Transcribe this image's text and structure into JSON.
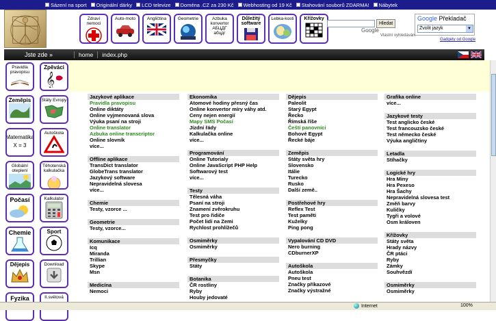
{
  "adbar": [
    "Sázení na sport",
    "Originální dárky",
    "LCD televize",
    "Doména .CZ za 230 Kč",
    "Webhosting od 19 Kč",
    "Stahování souborů ZDARMA!",
    "Nábytek"
  ],
  "header": {
    "categories": [
      {
        "label": "Zdraví nemoci",
        "bold": false
      },
      {
        "label": "Auto-moto",
        "bold": false
      },
      {
        "label": "Angličtina",
        "bold": false
      },
      {
        "label": "Geometrie",
        "bold": false
      },
      {
        "label": "Azbuka konvertor АБЦДГ абцдг",
        "bold": false
      },
      {
        "label": "Důležitý software",
        "bold": true
      },
      {
        "label": "Lebka-kosti",
        "bold": false
      },
      {
        "label": "Křížovky",
        "bold": true
      }
    ],
    "search_button": "Hledat",
    "search_label": "Vlastní vyhledávání",
    "google": "Google",
    "translator_title": "Překladač",
    "translator_select": "Zvolit jazyk",
    "translator_link": "Gadgety od Google"
  },
  "nav": {
    "here": "Jste zde »",
    "crumbs": [
      "home",
      "index.php"
    ]
  },
  "sidebar": [
    {
      "label": "Pravidla pravopisu"
    },
    {
      "label": "Zpěváci"
    },
    {
      "label": "Zeměpis"
    },
    {
      "label": "Státy Evropy"
    },
    {
      "label": "Matematika X = 3"
    },
    {
      "label": "Autoškola"
    },
    {
      "label": "Globální oteplení"
    },
    {
      "label": "Těhotenská kalkulačka"
    },
    {
      "label": "Počasí"
    },
    {
      "label": "Kalkulator"
    },
    {
      "label": "Chemie"
    },
    {
      "label": "Sport"
    },
    {
      "label": "Dějepis"
    },
    {
      "label": "Download"
    },
    {
      "label": "Fyzika"
    },
    {
      "label": "II.světová"
    }
  ],
  "columns": [
    [
      {
        "title": "Jazykové aplikace",
        "items": [
          {
            "t": "Pravidla pravopisu",
            "g": true
          },
          {
            "t": "Online diktáty",
            "g": false
          },
          {
            "t": "Online vyjmenovaná slova",
            "g": false
          },
          {
            "t": "Výuka psaní na stroji",
            "g": false
          },
          {
            "t": "Online translator",
            "g": true
          },
          {
            "t": "Azbuka online transcriptor",
            "g": true
          },
          {
            "t": "Online slovník",
            "g": false
          },
          {
            "t": "více...",
            "g": false
          }
        ]
      },
      {
        "title": "Offline aplikace",
        "items": [
          {
            "t": "TransDict translator",
            "g": false
          },
          {
            "t": "GlobeTrans translator",
            "g": false
          },
          {
            "t": "Jazykový software",
            "g": false
          },
          {
            "t": "Nepravidelná slovesa",
            "g": false
          },
          {
            "t": "více...",
            "g": false
          }
        ]
      },
      {
        "title": "Chemie",
        "items": [
          {
            "t": "Testy, vzorce ...",
            "g": false
          }
        ]
      },
      {
        "title": "Geometrie",
        "items": [
          {
            "t": "Testy, vzorce...",
            "g": false
          }
        ]
      },
      {
        "title": "Komunikace",
        "items": [
          {
            "t": "Icq",
            "g": false
          },
          {
            "t": "Miranda",
            "g": false
          },
          {
            "t": "Trillian",
            "g": false
          },
          {
            "t": "Skype",
            "g": false
          },
          {
            "t": "Msn",
            "g": false
          }
        ]
      },
      {
        "title": "Medicína",
        "items": [
          {
            "t": "Nemoci",
            "g": false
          }
        ]
      }
    ],
    [
      {
        "title": "Ekonomika",
        "items": [
          {
            "t": "Atomové hodiny přesný čas",
            "g": false
          },
          {
            "t": "Online konvertor míry váhy atd.",
            "g": false
          },
          {
            "t": "Ceny nejen energií",
            "g": false
          },
          {
            "t": "Mapy SMS Počasí",
            "g": true
          },
          {
            "t": "Jízdní řády",
            "g": false
          },
          {
            "t": "Kalkulačka online",
            "g": false
          },
          {
            "t": "více...",
            "g": false
          }
        ]
      },
      {
        "title": "Programování",
        "items": [
          {
            "t": "Online Tutorialy",
            "g": false
          },
          {
            "t": "Online JavaScript PHP Help",
            "g": false
          },
          {
            "t": "Softwarový test",
            "g": false
          },
          {
            "t": "více...",
            "g": false
          }
        ]
      },
      {
        "title": "Testy",
        "items": [
          {
            "t": "Tělesná váha",
            "g": false
          },
          {
            "t": "Psaní na stroji",
            "g": false
          },
          {
            "t": "Znamení zvěrokruhu",
            "g": false
          },
          {
            "t": "Test pro řidiče",
            "g": false
          },
          {
            "t": "Počet lidí na Zemi",
            "g": false
          },
          {
            "t": "Rychlost prohlížečů",
            "g": false
          }
        ]
      },
      {
        "title": "Osmiměrky",
        "items": [
          {
            "t": "Osmiměrky",
            "g": false
          }
        ]
      },
      {
        "title": "Přesmyčky",
        "items": [
          {
            "t": "Státy",
            "g": false
          }
        ]
      },
      {
        "title": "Botanika",
        "items": [
          {
            "t": "ČR rostliny",
            "g": false
          },
          {
            "t": "Ryby",
            "g": false
          },
          {
            "t": "Houby jedovaté",
            "g": false
          }
        ]
      }
    ],
    [
      {
        "title": "Dějepis",
        "items": [
          {
            "t": "Paleolit",
            "g": false
          },
          {
            "t": "Starý Egypt",
            "g": false
          },
          {
            "t": "Řecko",
            "g": false
          },
          {
            "t": "Římská říše",
            "g": false
          },
          {
            "t": "Čeští panovníci",
            "g": true
          },
          {
            "t": "Bohové Egypt",
            "g": false
          },
          {
            "t": "Řecké báje",
            "g": false
          }
        ]
      },
      {
        "title": "Zeměpis",
        "items": [
          {
            "t": "Státy světa hry",
            "g": false
          },
          {
            "t": "Slovensko",
            "g": false
          },
          {
            "t": "Itálie",
            "g": false
          },
          {
            "t": "Turecko",
            "g": false
          },
          {
            "t": "Rusko",
            "g": false
          },
          {
            "t": "Další země..",
            "g": false
          }
        ]
      },
      {
        "title": "Postřehové hry",
        "items": [
          {
            "t": "Reflex Test",
            "g": false
          },
          {
            "t": "Test paměti",
            "g": false
          },
          {
            "t": "Kuželky",
            "g": false
          },
          {
            "t": "Ping pong",
            "g": false
          }
        ]
      },
      {
        "title": "Vypalování CD DVD",
        "items": [
          {
            "t": "Nero burning",
            "g": false
          },
          {
            "t": "CDburnerXP",
            "g": false
          }
        ]
      },
      {
        "title": "Autoškola",
        "items": [
          {
            "t": "Autoškola",
            "g": false
          },
          {
            "t": "Pneu test",
            "g": false
          },
          {
            "t": "Značky příkazové",
            "g": false
          },
          {
            "t": "Značky výstražné",
            "g": false
          }
        ]
      }
    ],
    [
      {
        "title": "Grafika online",
        "items": [
          {
            "t": "více...",
            "g": false
          }
        ]
      },
      {
        "title": "Jazykové testy",
        "items": [
          {
            "t": "Test anglicko české",
            "g": false
          },
          {
            "t": "Test francouzsko české",
            "g": false
          },
          {
            "t": "Test německo české",
            "g": false
          },
          {
            "t": "Výuka angličtiny",
            "g": false
          }
        ]
      },
      {
        "title": "Letadla",
        "items": [
          {
            "t": "Stíhačky",
            "g": false
          }
        ]
      },
      {
        "title": "Logické hry",
        "items": [
          {
            "t": "Hra Miny",
            "g": false
          },
          {
            "t": "Hra Pexeso",
            "g": false
          },
          {
            "t": "Hra Šachy",
            "g": false
          },
          {
            "t": "Nepravidelná slovesa test",
            "g": false
          },
          {
            "t": "Změň barvy",
            "g": false
          },
          {
            "t": "Kuličky",
            "g": false
          },
          {
            "t": "Tygři a volové",
            "g": false
          },
          {
            "t": "Osm královen",
            "g": false
          }
        ]
      },
      {
        "title": "Křížovky",
        "items": [
          {
            "t": "Státy světa",
            "g": false
          },
          {
            "t": "Hrady názvy",
            "g": false
          },
          {
            "t": "ČR ptáci",
            "g": false
          },
          {
            "t": "Ryby",
            "g": false
          },
          {
            "t": "Zámky",
            "g": false
          },
          {
            "t": "Souhvězdí",
            "g": false
          }
        ]
      },
      {
        "title": "Osmiměrky",
        "items": [
          {
            "t": "Osmiměrky",
            "g": false
          }
        ]
      }
    ]
  ],
  "status": {
    "zone": "Internet",
    "zoom": "100%"
  },
  "colors": {
    "accent_border": "#5b2fb4",
    "green_link": "#2a8a1c",
    "ad_bar": "#1c1c8c"
  }
}
